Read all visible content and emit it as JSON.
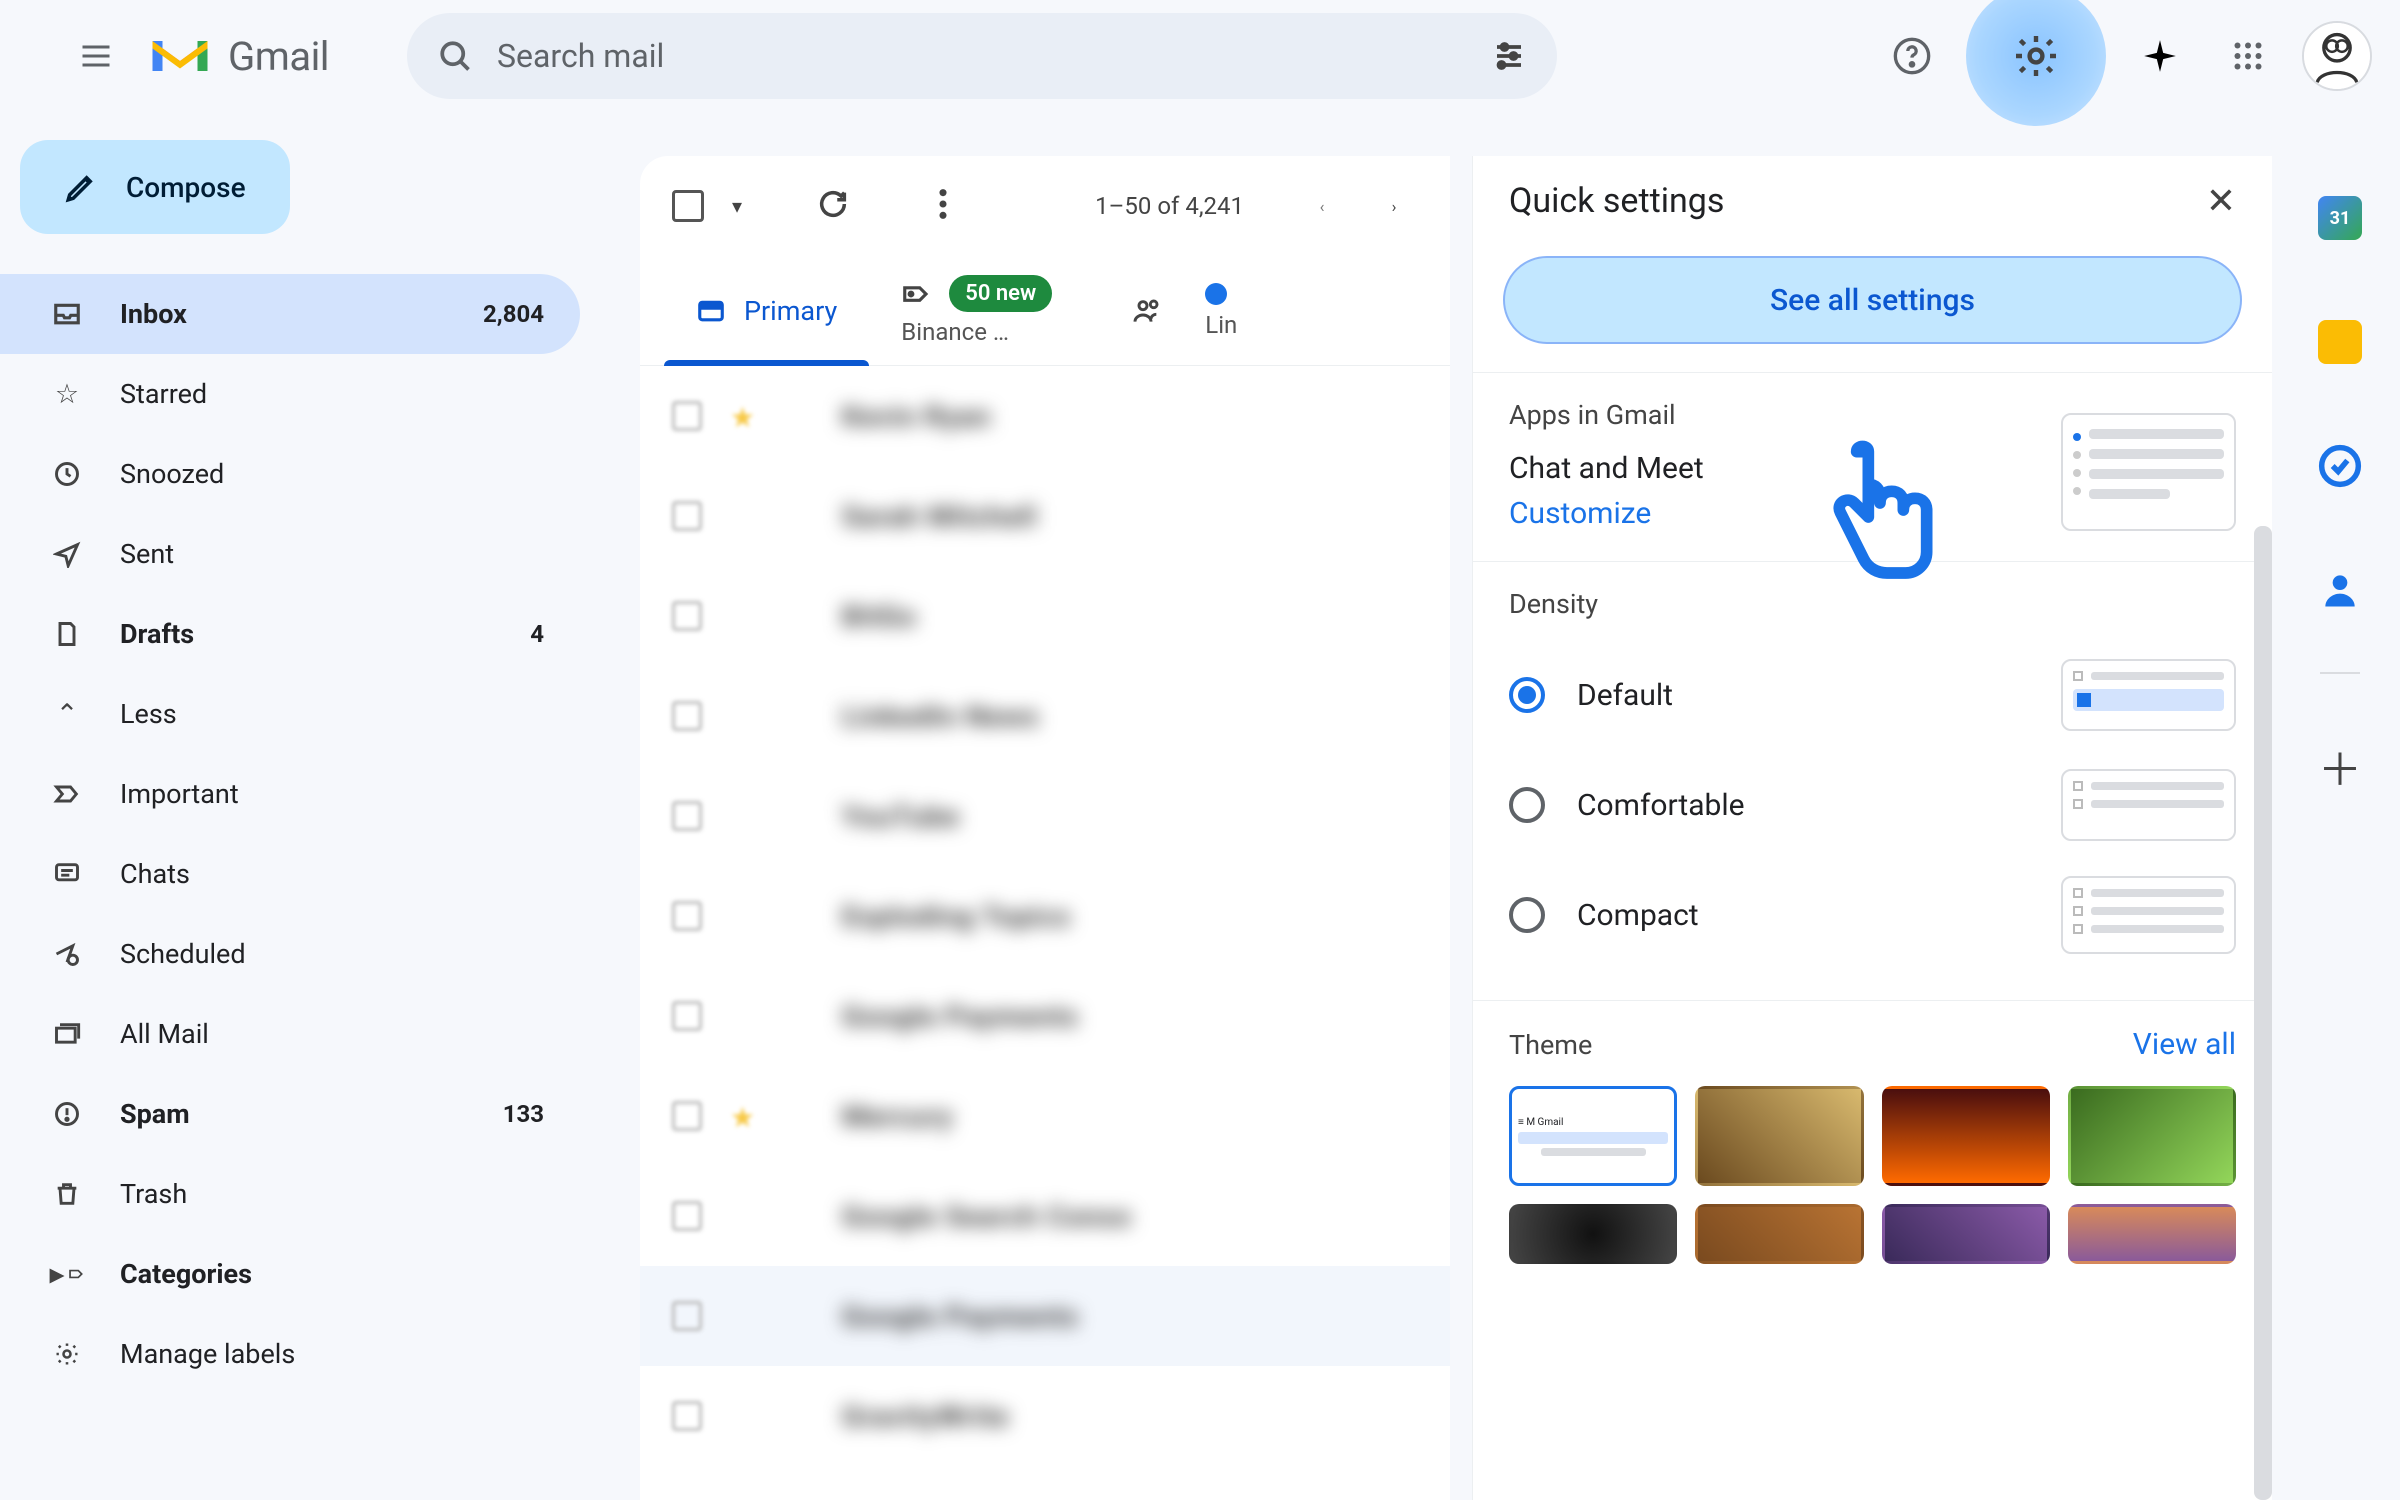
{
  "header": {
    "app_name": "Gmail",
    "search_placeholder": "Search mail"
  },
  "compose_label": "Compose",
  "nav": {
    "inbox": {
      "label": "Inbox",
      "count": "2,804"
    },
    "starred": {
      "label": "Starred"
    },
    "snoozed": {
      "label": "Snoozed"
    },
    "sent": {
      "label": "Sent"
    },
    "drafts": {
      "label": "Drafts",
      "count": "4"
    },
    "less": {
      "label": "Less"
    },
    "important": {
      "label": "Important"
    },
    "chats": {
      "label": "Chats"
    },
    "scheduled": {
      "label": "Scheduled"
    },
    "allmail": {
      "label": "All Mail"
    },
    "spam": {
      "label": "Spam",
      "count": "133"
    },
    "trash": {
      "label": "Trash"
    },
    "categories": {
      "label": "Categories"
    },
    "manage": {
      "label": "Manage labels"
    }
  },
  "toolbar": {
    "range": "1–50 of 4,241"
  },
  "tabs": {
    "primary": "Primary",
    "promotions_badge": "50 new",
    "promotions_sub": "Binance …",
    "updates_sub": "Lin"
  },
  "messages": [
    {
      "sender": "Kevin Ryan",
      "starred": true
    },
    {
      "sender": "Sarah Mitchell",
      "starred": false
    },
    {
      "sender": "BitGo",
      "starred": false
    },
    {
      "sender": "LinkedIn News",
      "starred": false
    },
    {
      "sender": "YouTube",
      "starred": false
    },
    {
      "sender": "Exploding Topics",
      "starred": false
    },
    {
      "sender": "Google Payments",
      "starred": false
    },
    {
      "sender": "Mercury",
      "starred": true
    },
    {
      "sender": "Google Search Conso",
      "starred": false
    },
    {
      "sender": "Google Payments",
      "starred": false,
      "hover": true
    },
    {
      "sender": "GravityWrite",
      "starred": false
    }
  ],
  "qs": {
    "title": "Quick settings",
    "see_all": "See all settings",
    "apps_title": "Apps in Gmail",
    "chat_meet": "Chat and Meet",
    "customize": "Customize",
    "density_title": "Density",
    "density": {
      "default": "Default",
      "comfortable": "Comfortable",
      "compact": "Compact"
    },
    "theme_title": "Theme",
    "view_all": "View all"
  }
}
